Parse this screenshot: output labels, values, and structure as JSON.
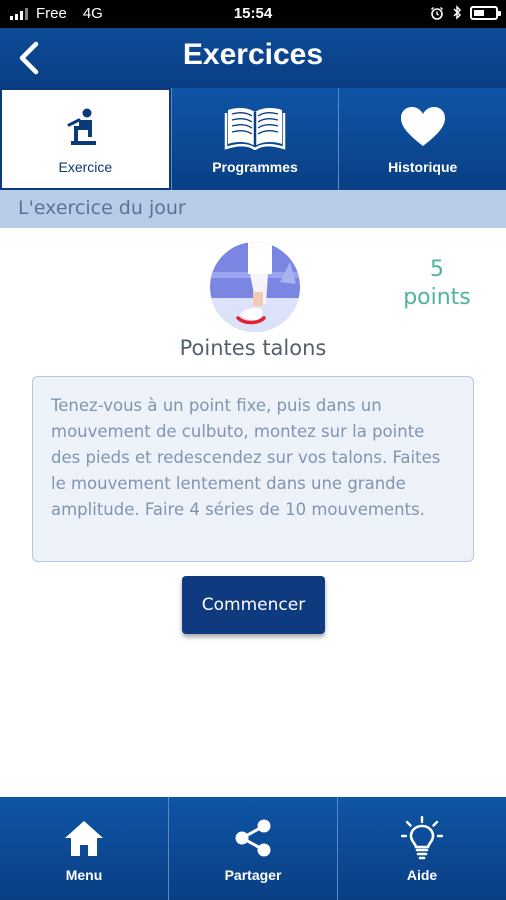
{
  "status_bar": {
    "carrier": "Free",
    "network": "4G",
    "time": "15:54",
    "icons": [
      "alarm-icon",
      "bluetooth-icon",
      "battery-icon"
    ]
  },
  "header": {
    "title": "Exercices",
    "back_icon": "chevron-left-icon"
  },
  "tabs": [
    {
      "label": "Exercice",
      "icon": "exercise-person-icon",
      "active": true
    },
    {
      "label": "Programmes",
      "icon": "book-icon",
      "active": false
    },
    {
      "label": "Historique",
      "icon": "heart-icon",
      "active": false
    }
  ],
  "section": {
    "title": "L'exercice du jour"
  },
  "exercise": {
    "name": "Pointes talons",
    "points_value": "5",
    "points_unit": "points",
    "description": "Tenez-vous à un point fixe, puis dans un mouvement de culbuto, montez sur la pointe des pieds et redescendez sur vos talons. Faites le mouvement lentement dans une grande amplitude. Faire 4 séries de 10 mouvements.",
    "start_label": "Commencer"
  },
  "bottom_nav": [
    {
      "label": "Menu",
      "icon": "home-icon"
    },
    {
      "label": "Partager",
      "icon": "share-icon"
    },
    {
      "label": "Aide",
      "icon": "lightbulb-icon"
    }
  ],
  "colors": {
    "primary": "#0a3f84",
    "section_band": "#b7cce6",
    "points": "#4fb3a0",
    "description_text": "#7f95b0",
    "button": "#0f3a80"
  }
}
